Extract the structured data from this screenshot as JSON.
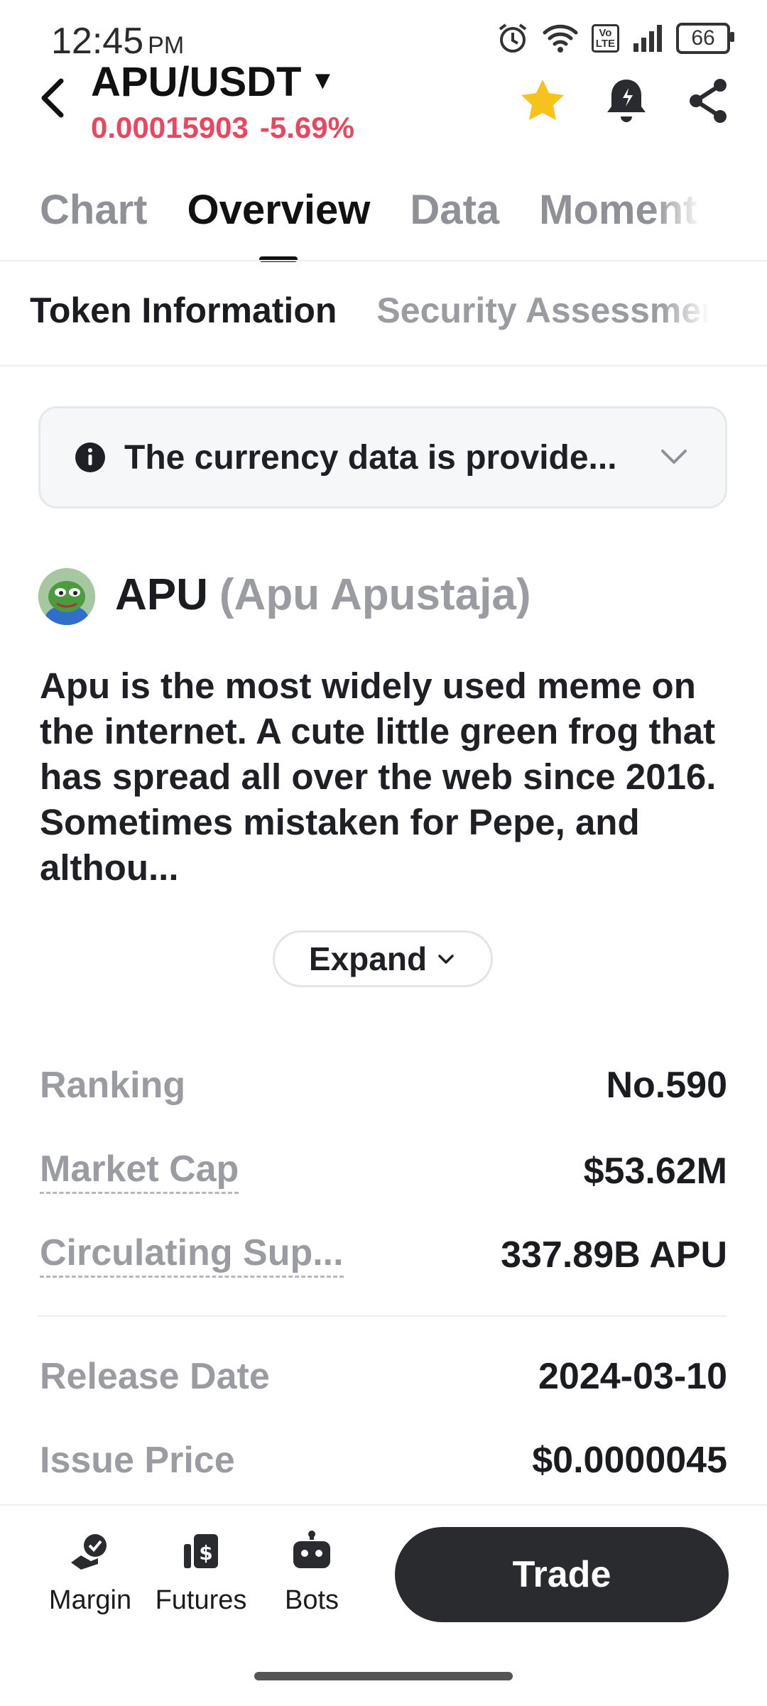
{
  "status_bar": {
    "time": "12:45",
    "ampm": "PM",
    "battery": "66"
  },
  "header": {
    "pair": "APU/USDT",
    "price": "0.00015903",
    "change": "-5.69%",
    "star_color": "#f7c21b",
    "price_color": "#e8475f"
  },
  "tabs": [
    {
      "label": "Chart"
    },
    {
      "label": "Overview"
    },
    {
      "label": "Data"
    },
    {
      "label": "Moment"
    }
  ],
  "subtabs": [
    {
      "label": "Token Information"
    },
    {
      "label": "Security Assessment"
    }
  ],
  "notice": {
    "text": "The currency data is provide..."
  },
  "token": {
    "symbol": "APU",
    "full_name": "(Apu Apustaja)",
    "description": "Apu is the most widely used meme on the internet. A cute little green frog that has spread all over the web since 2016. Sometimes mistaken for Pepe, and althou...",
    "expand_label": "Expand"
  },
  "stats": [
    {
      "label": "Ranking",
      "value": "No.590"
    },
    {
      "label": "Market Cap",
      "value": "$53.62M"
    },
    {
      "label": "Circulating Sup...",
      "value": "337.89B APU"
    }
  ],
  "details": [
    {
      "label": "Release Date",
      "value": "2024-03-10"
    },
    {
      "label": "Issue Price",
      "value": "$0.0000045"
    }
  ],
  "bottom_nav": {
    "items": [
      {
        "label": "Margin",
        "icon": "margin-icon"
      },
      {
        "label": "Futures",
        "icon": "futures-icon"
      },
      {
        "label": "Bots",
        "icon": "bots-icon"
      }
    ],
    "trade_label": "Trade"
  }
}
